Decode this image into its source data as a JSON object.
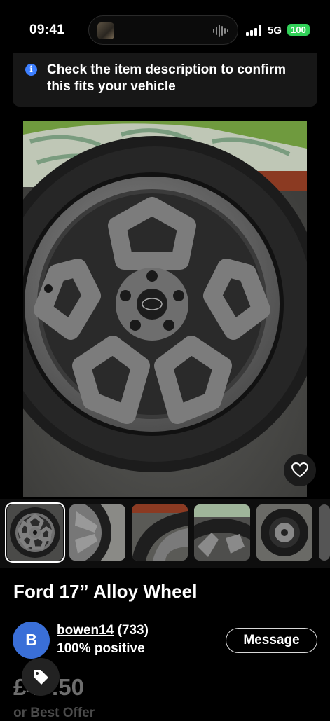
{
  "status_bar": {
    "time": "09:41",
    "network": "5G",
    "battery": "100",
    "battery_color": "#31d158"
  },
  "notice": {
    "icon": "info-icon",
    "text": "Check the item description to confirm this fits your vehicle"
  },
  "gallery": {
    "main_image": "alloy-wheel-photo",
    "favorite_icon": "heart-icon",
    "thumbnails": [
      {
        "name": "thumbnail-1",
        "selected": true
      },
      {
        "name": "thumbnail-2",
        "selected": false
      },
      {
        "name": "thumbnail-3",
        "selected": false
      },
      {
        "name": "thumbnail-4",
        "selected": false
      },
      {
        "name": "thumbnail-5",
        "selected": false
      }
    ]
  },
  "listing": {
    "title": "Ford 17” Alloy Wheel",
    "price": "£47.50",
    "offer_text": "or Best Offer"
  },
  "seller": {
    "avatar_letter": "B",
    "username": "bowen14",
    "feedback_count": "(733)",
    "positive": "100% positive",
    "message_label": "Message"
  },
  "colors": {
    "accent_blue": "#3d7fff",
    "avatar_blue": "#3a6fd8"
  }
}
